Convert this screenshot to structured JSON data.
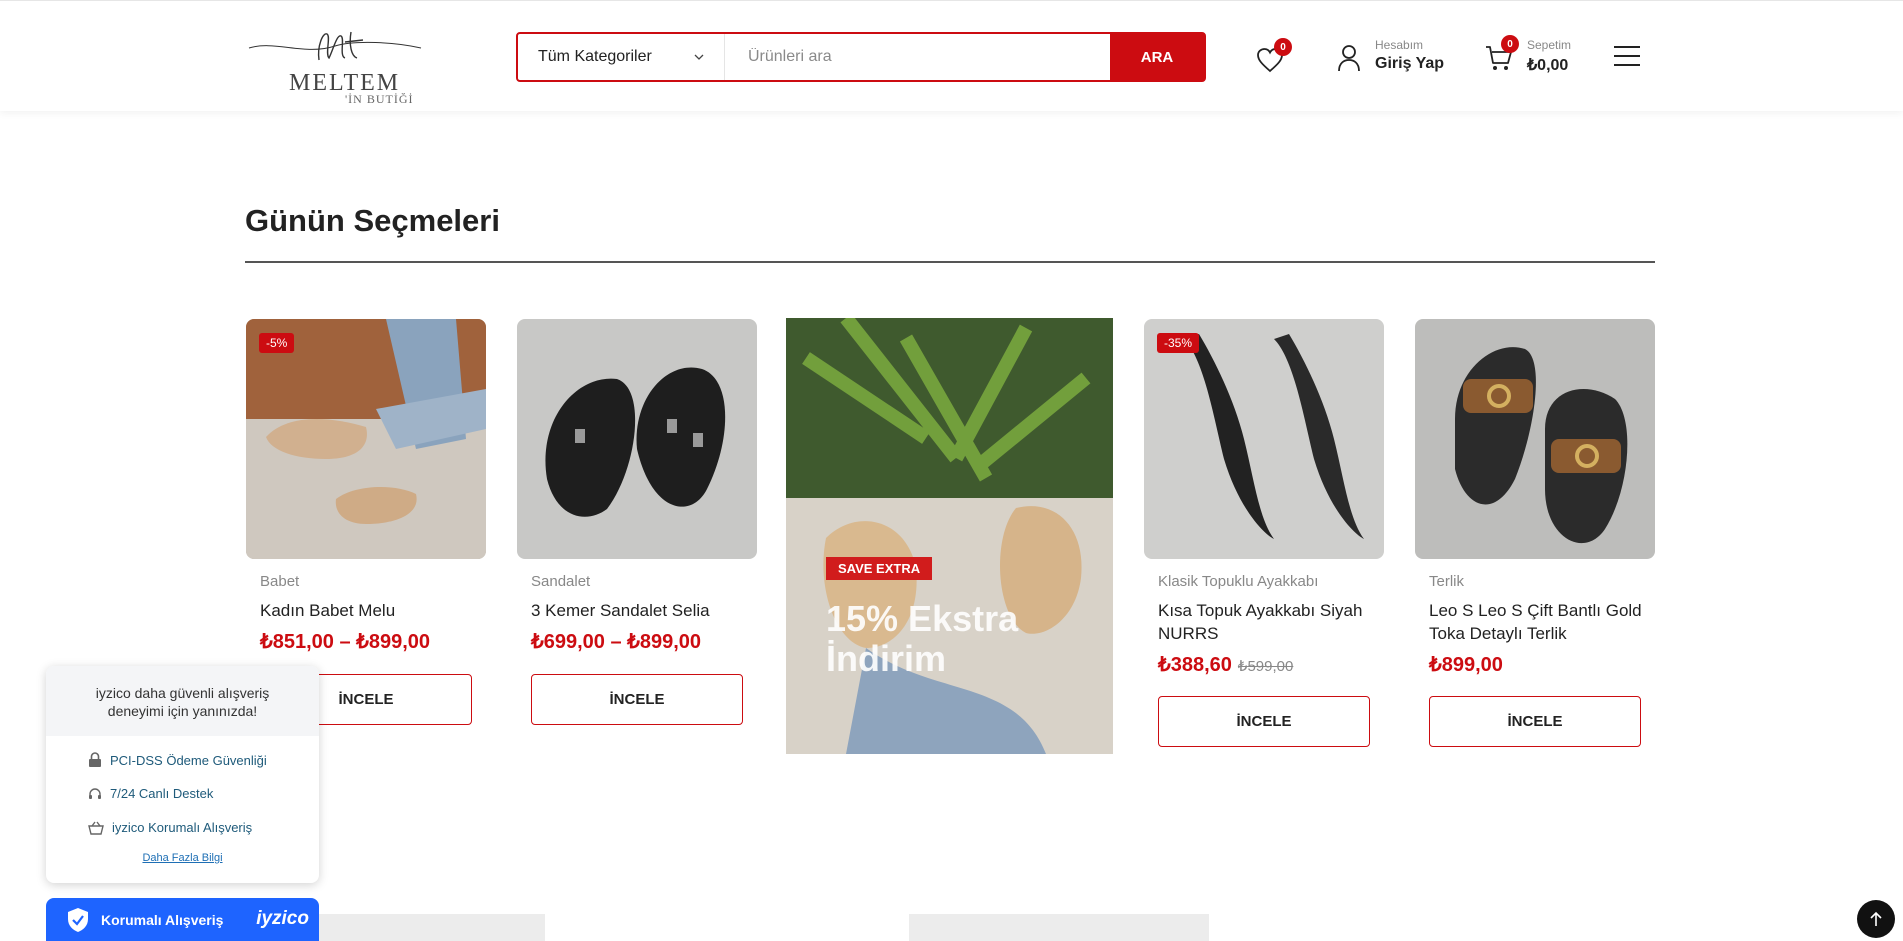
{
  "header": {
    "logo": {
      "script": "Mt",
      "name": "MELTEM",
      "sub": "'İN BUTİĞİ"
    },
    "search": {
      "category": "Tüm Kategoriler",
      "placeholder": "Ürünleri ara",
      "button": "ARA"
    },
    "wishlist_count": "0",
    "account": {
      "label": "Hesabım",
      "action": "Giriş Yap"
    },
    "cart": {
      "count": "0",
      "label": "Sepetim",
      "total": "₺0,00"
    },
    "icons": [
      "heart-icon",
      "user-icon",
      "cart-icon",
      "hamburger-menu-icon"
    ]
  },
  "section": {
    "title": "Günün Seçmeleri"
  },
  "products": [
    {
      "discount": "-5%",
      "category": "Babet",
      "title": "Kadın Babet Melu",
      "price": "₺851,00 – ₺899,00",
      "old_price": "",
      "button": "İNCELE"
    },
    {
      "discount": "",
      "category": "Sandalet",
      "title": "3 Kemer Sandalet Selia",
      "price": "₺699,00 – ₺899,00",
      "old_price": "",
      "button": "İNCELE"
    },
    {
      "discount": "-35%",
      "category": "Klasik Topuklu Ayakkabı",
      "title": "Kısa Topuk Ayakkabı Siyah NURRS",
      "price": "₺388,60",
      "old_price": "₺599,00",
      "button": "İNCELE"
    },
    {
      "discount": "",
      "category": "Terlik",
      "title": "Leo S Leo S Çift Bantlı Gold Toka Detaylı Terlik",
      "price": "₺899,00",
      "old_price": "",
      "button": "İNCELE"
    }
  ],
  "promo": {
    "tag": "SAVE EXTRA",
    "text": "15% Ekstra İndirim"
  },
  "iyzico": {
    "headline": "iyzico daha güvenli alışveriş deneyimi için yanınızda!",
    "items": [
      "PCI-DSS Ödeme Güvenliği",
      "7/24 Canlı Destek",
      "iyzico Korumalı Alışveriş"
    ],
    "more": "Daha Fazla Bilgi",
    "bar_label": "Korumalı Alışveriş",
    "brand": "iyzico"
  },
  "colors": {
    "accent": "#cc0c11",
    "iyzico": "#1e64ff"
  }
}
